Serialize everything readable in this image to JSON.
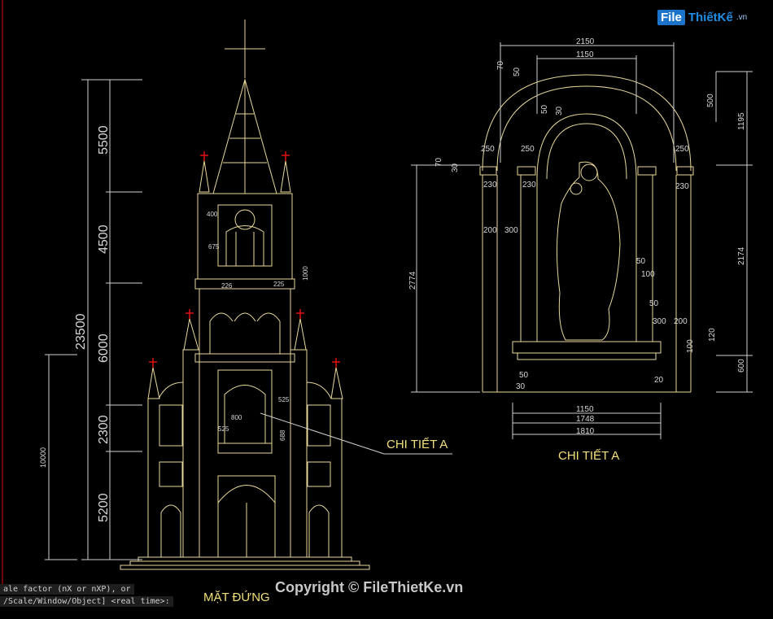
{
  "logo": {
    "brand": "File",
    "name": "ThiếtKế",
    "tld": ".vn"
  },
  "copyright": "Copyright © FileThietKe.vn",
  "command_line": {
    "line1": "ale factor (nX or nXP), or",
    "line2": "/Scale/Window/Object] <real time>:"
  },
  "elevation": {
    "title": "MẶT ĐỨNG",
    "callout": "CHI TIẾT A",
    "dim_total": "23500",
    "dim_segments": [
      "5500",
      "4500",
      "6000",
      "2300",
      "5200"
    ],
    "dim_left": "10000",
    "small_dims": [
      "400",
      "675",
      "226",
      "225",
      "1000",
      "525",
      "525",
      "800",
      "688"
    ]
  },
  "detail": {
    "title": "CHI TIẾT A",
    "top_dims": [
      "2150",
      "1150"
    ],
    "bottom_dims": [
      "1150",
      "1748",
      "1810"
    ],
    "left_dims": [
      "70",
      "50",
      "50",
      "30",
      "70",
      "30",
      "2774"
    ],
    "side_dims": [
      "250",
      "250",
      "250",
      "230",
      "230",
      "230",
      "200",
      "300",
      "50",
      "100",
      "50",
      "300",
      "200",
      "100",
      "120",
      "50",
      "30",
      "20"
    ],
    "right_dims": [
      "500",
      "1195",
      "2174",
      "600"
    ]
  },
  "colors": {
    "accent": "#f2e07a",
    "line": "#e8d89a",
    "dim": "#cfcfcf",
    "red": "#e01010"
  }
}
